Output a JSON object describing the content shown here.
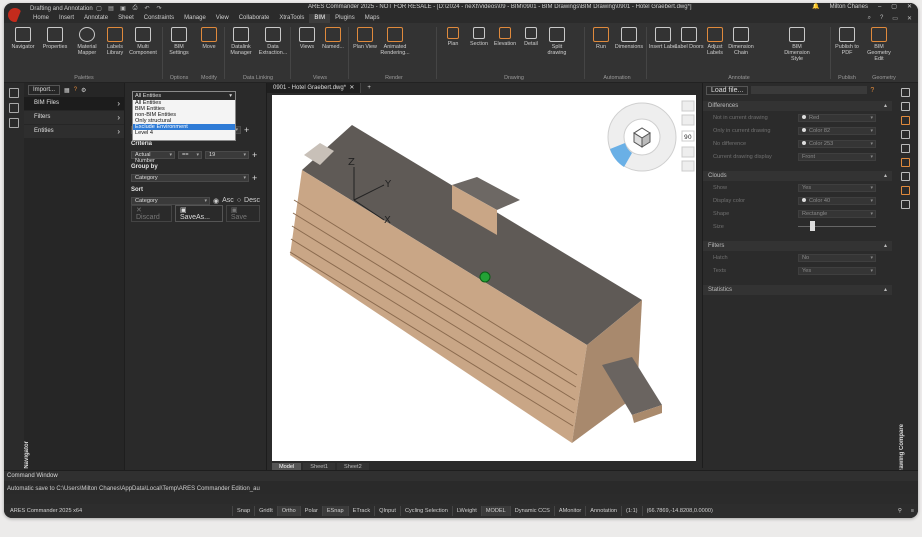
{
  "titlebar": {
    "workspace": "Drafting and Annotation",
    "title": "ARES Commander 2025 - NOT FOR RESALE - [D:\\2024 - neXt\\Videos\\09 - BIM\\0901 - BIM Drawings\\BIM Drawing\\0901 - Hotel Graebert.dwg*]",
    "user": "Milton Chanes"
  },
  "menu": [
    "Home",
    "Insert",
    "Annotate",
    "Sheet",
    "Constraints",
    "Manage",
    "View",
    "Collaborate",
    "XtraTools",
    "BIM",
    "Plugins",
    "Maps"
  ],
  "menu_active": "BIM",
  "ribbon": {
    "buttons": [
      "Navigator",
      "Properties",
      "Material Mapper",
      "Labels Library",
      "Multi Component",
      "BIM Settings",
      "Move",
      "Datalink Manager",
      "Data Extraction...",
      "Views",
      "Named...",
      "Plan View",
      "Animated Rendering...",
      "Plan",
      "Section",
      "Elevation",
      "Detail",
      "Split drawing",
      "Run",
      "Dimensions",
      "Insert Label",
      "Label Doors",
      "Adjust Labels",
      "Dimension Chain",
      "BIM Dimension Style",
      "Publish to PDF",
      "BIM Geometry Edit"
    ],
    "groups": [
      "Palettes",
      "Options",
      "Modify",
      "Data Linking",
      "Views",
      "Render",
      "Drawing",
      "Automation",
      "Annotate",
      "Publish",
      "Geometry"
    ]
  },
  "navigator": {
    "import_label": "Import...",
    "items": [
      "BIM Files",
      "Filters",
      "Entities"
    ],
    "vertical_label": "BIM Navigator"
  },
  "filter": {
    "selected": "All Entities",
    "options": [
      "All Entities",
      "BIM Entities",
      "non-BIM Entities",
      "Only structural",
      "Exclude Environment",
      "Level 4"
    ],
    "highlighted": "Exclude Environment",
    "criteria_label": "Criteria",
    "criteria_field": "Actual Number",
    "criteria_op": "==",
    "criteria_value": "19",
    "group_by_label": "Group by",
    "group_by_value": "Category",
    "sort_label": "Sort",
    "sort_value": "Category",
    "asc": "Asc",
    "desc": "Desc",
    "discard": "Discard",
    "save_as": "SaveAs...",
    "save": "Save"
  },
  "viewport": {
    "tab": "0901 - Hotel Graebert.dwg*",
    "layouts": [
      "Model",
      "Sheet1",
      "Sheet2"
    ],
    "cube_value": "90",
    "axes": [
      "Z",
      "Y",
      "X"
    ]
  },
  "compare": {
    "load_label": "Load file...",
    "vertical_label": "Drawing Compare",
    "differences_title": "Differences",
    "differences": [
      {
        "label": "Not in current drawing",
        "value": "Red"
      },
      {
        "label": "Only in current drawing",
        "value": "Color 82"
      },
      {
        "label": "No difference",
        "value": "Color 253"
      },
      {
        "label": "Current drawing display",
        "value": "Front"
      }
    ],
    "clouds_title": "Clouds",
    "clouds": [
      {
        "label": "Show",
        "value": "Yes"
      },
      {
        "label": "Display color",
        "value": "Color 40"
      },
      {
        "label": "Shape",
        "value": "Rectangle"
      },
      {
        "label": "Size",
        "value": ""
      }
    ],
    "filters_title": "Filters",
    "filters": [
      {
        "label": "Hatch",
        "value": "No"
      },
      {
        "label": "Texts",
        "value": "Yes"
      }
    ],
    "statistics_title": "Statistics"
  },
  "command": {
    "title": "Command Window",
    "line": "Automatic save to C:\\Users\\Milton Chanes\\AppData\\Local\\Temp\\ARES Commander Edition_au"
  },
  "status": {
    "app": "ARES Commander 2025 x64",
    "toggles": [
      "Snap",
      "GridIt",
      "Ortho",
      "Polar",
      "ESnap",
      "ETrack",
      "QInput",
      "Cycling Selection",
      "LWeight",
      "MODEL",
      "Dynamic CCS",
      "AMonitor",
      "Annotation"
    ],
    "scale": "(1:1)",
    "coords": "(66.7869,-14.8208,0.0000)"
  },
  "colors": {
    "accent": "#2e7bd6",
    "brand": "#c42b1c",
    "ribbon_icon_orange": "#e08a3c"
  }
}
